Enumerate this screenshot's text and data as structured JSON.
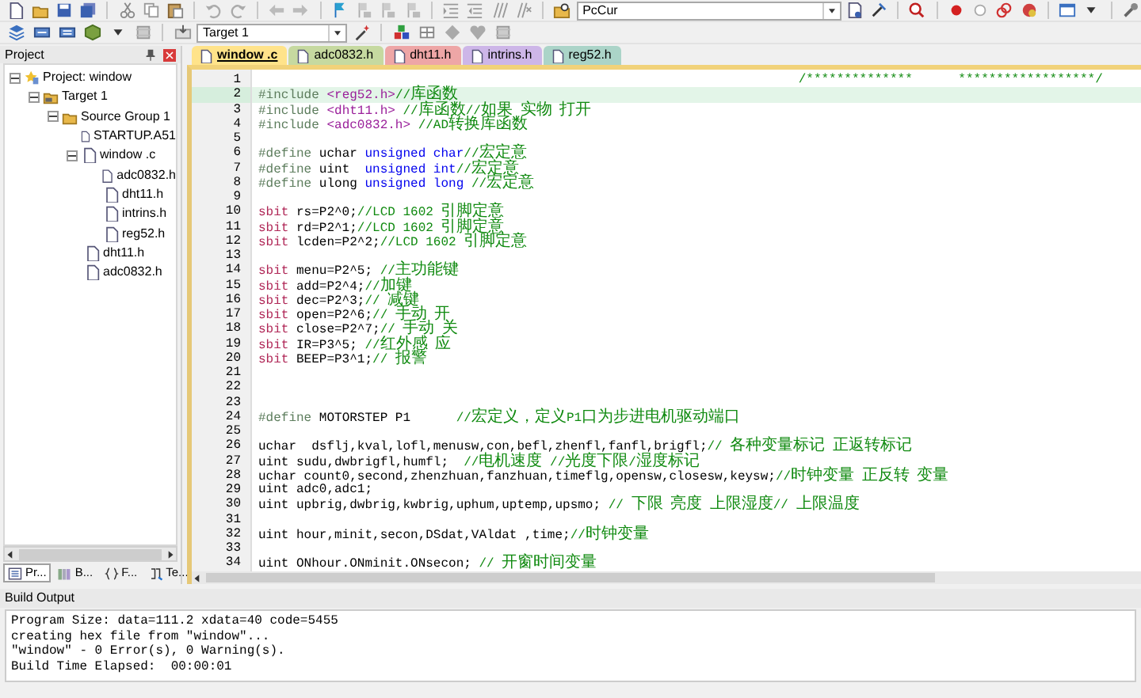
{
  "toolbar": {
    "debug_combo": {
      "value": "PcCur"
    },
    "target_combo": {
      "value": "Target 1"
    }
  },
  "project_panel": {
    "title": "Project",
    "tree": [
      {
        "label": "Project: window",
        "kind": "project",
        "expanded": true,
        "children": [
          {
            "label": "Target 1",
            "kind": "target",
            "expanded": true,
            "children": [
              {
                "label": "Source Group 1",
                "kind": "group",
                "expanded": true,
                "children": [
                  {
                    "label": "STARTUP.A51",
                    "kind": "file"
                  },
                  {
                    "label": "window .c",
                    "kind": "file",
                    "expanded": true,
                    "children": [
                      {
                        "label": "adc0832.h",
                        "kind": "file"
                      },
                      {
                        "label": "dht11.h",
                        "kind": "file"
                      },
                      {
                        "label": "intrins.h",
                        "kind": "file"
                      },
                      {
                        "label": "reg52.h",
                        "kind": "file"
                      }
                    ]
                  },
                  {
                    "label": "dht11.h",
                    "kind": "file"
                  },
                  {
                    "label": "adc0832.h",
                    "kind": "file"
                  }
                ]
              }
            ]
          }
        ]
      }
    ],
    "tabs": [
      {
        "label": "Pr...",
        "kind": "project",
        "selected": true
      },
      {
        "label": "B...",
        "kind": "books",
        "selected": false
      },
      {
        "label": "F...",
        "kind": "functions",
        "selected": false
      },
      {
        "label": "Te...",
        "kind": "templates",
        "selected": false
      }
    ]
  },
  "editor": {
    "tabs": [
      {
        "label": "window .c",
        "selected": true,
        "color": "#ffe38a"
      },
      {
        "label": "adc0832.h",
        "selected": false,
        "color": "#c6d9a0"
      },
      {
        "label": "dht11.h",
        "selected": false,
        "color": "#eea6a6"
      },
      {
        "label": "intrins.h",
        "selected": false,
        "color": "#cdb6e8"
      },
      {
        "label": "reg52.h",
        "selected": false,
        "color": "#abd4c8"
      }
    ],
    "lines": [
      {
        "number": "1",
        "current": false,
        "segments": [
          {
            "kind": "comment",
            "text": "                                                                       /**************      ******************/"
          }
        ]
      },
      {
        "number": "2",
        "current": true,
        "segments": [
          {
            "kind": "pp",
            "text": "#include "
          },
          {
            "kind": "header",
            "text": "<reg52.h>"
          },
          {
            "kind": "comment",
            "text": "//库函数"
          }
        ]
      },
      {
        "number": "3",
        "current": false,
        "segments": [
          {
            "kind": "pp",
            "text": "#include "
          },
          {
            "kind": "header",
            "text": "<dht11.h> "
          },
          {
            "kind": "comment",
            "text": "//库函数//如果 实物 打开"
          }
        ]
      },
      {
        "number": "4",
        "current": false,
        "segments": [
          {
            "kind": "pp",
            "text": "#include "
          },
          {
            "kind": "header",
            "text": "<adc0832.h> "
          },
          {
            "kind": "comment",
            "text": "//AD转换库函数"
          }
        ]
      },
      {
        "number": "5",
        "current": false
      },
      {
        "number": "6",
        "current": false,
        "segments": [
          {
            "kind": "pp",
            "text": "#define"
          },
          {
            "kind": "plain",
            "text": " uchar "
          },
          {
            "kind": "type",
            "text": "unsigned char"
          },
          {
            "kind": "comment",
            "text": "//宏定意"
          }
        ]
      },
      {
        "number": "7",
        "current": false,
        "segments": [
          {
            "kind": "pp",
            "text": "#define"
          },
          {
            "kind": "plain",
            "text": " uint  "
          },
          {
            "kind": "type",
            "text": "unsigned int"
          },
          {
            "kind": "comment",
            "text": "//宏定意"
          }
        ]
      },
      {
        "number": "8",
        "current": false,
        "segments": [
          {
            "kind": "pp",
            "text": "#define"
          },
          {
            "kind": "plain",
            "text": " ulong "
          },
          {
            "kind": "type",
            "text": "unsigned long "
          },
          {
            "kind": "comment",
            "text": "//宏定意"
          }
        ]
      },
      {
        "number": "9",
        "current": false
      },
      {
        "number": "10",
        "current": false,
        "segments": [
          {
            "kind": "keyword",
            "text": "sbit"
          },
          {
            "kind": "plain",
            "text": " rs=P2^0;"
          },
          {
            "kind": "comment",
            "text": "//LCD 1602 引脚定意"
          }
        ]
      },
      {
        "number": "11",
        "current": false,
        "segments": [
          {
            "kind": "keyword",
            "text": "sbit"
          },
          {
            "kind": "plain",
            "text": " rd=P2^1;"
          },
          {
            "kind": "comment",
            "text": "//LCD 1602 引脚定意"
          }
        ]
      },
      {
        "number": "12",
        "current": false,
        "segments": [
          {
            "kind": "keyword",
            "text": "sbit"
          },
          {
            "kind": "plain",
            "text": " lcden=P2^2;"
          },
          {
            "kind": "comment",
            "text": "//LCD 1602 引脚定意"
          }
        ]
      },
      {
        "number": "13",
        "current": false
      },
      {
        "number": "14",
        "current": false,
        "segments": [
          {
            "kind": "keyword",
            "text": "sbit"
          },
          {
            "kind": "plain",
            "text": " menu=P2^5; "
          },
          {
            "kind": "comment",
            "text": "//主功能键"
          }
        ]
      },
      {
        "number": "15",
        "current": false,
        "segments": [
          {
            "kind": "keyword",
            "text": "sbit"
          },
          {
            "kind": "plain",
            "text": " add=P2^4;"
          },
          {
            "kind": "comment",
            "text": "//加键"
          }
        ]
      },
      {
        "number": "16",
        "current": false,
        "segments": [
          {
            "kind": "keyword",
            "text": "sbit"
          },
          {
            "kind": "plain",
            "text": " dec=P2^3;"
          },
          {
            "kind": "comment",
            "text": "// 减键"
          }
        ]
      },
      {
        "number": "17",
        "current": false,
        "segments": [
          {
            "kind": "keyword",
            "text": "sbit"
          },
          {
            "kind": "plain",
            "text": " open=P2^6;"
          },
          {
            "kind": "comment",
            "text": "// 手动 开"
          }
        ]
      },
      {
        "number": "18",
        "current": false,
        "segments": [
          {
            "kind": "keyword",
            "text": "sbit"
          },
          {
            "kind": "plain",
            "text": " close=P2^7;"
          },
          {
            "kind": "comment",
            "text": "// 手动 关"
          }
        ]
      },
      {
        "number": "19",
        "current": false,
        "segments": [
          {
            "kind": "keyword",
            "text": "sbit"
          },
          {
            "kind": "plain",
            "text": " IR=P3^5; "
          },
          {
            "kind": "comment",
            "text": "//红外感 应"
          }
        ]
      },
      {
        "number": "20",
        "current": false,
        "segments": [
          {
            "kind": "keyword",
            "text": "sbit"
          },
          {
            "kind": "plain",
            "text": " BEEP=P3^1;"
          },
          {
            "kind": "comment",
            "text": "// 报警"
          }
        ]
      },
      {
        "number": "21",
        "current": false
      },
      {
        "number": "22",
        "current": false
      },
      {
        "number": "23",
        "current": false
      },
      {
        "number": "24",
        "current": false,
        "segments": [
          {
            "kind": "pp",
            "text": "#define"
          },
          {
            "kind": "plain",
            "text": " MOTORSTEP P1      "
          },
          {
            "kind": "comment",
            "text": "//宏定义，定义P1口为步进电机驱动端口"
          }
        ]
      },
      {
        "number": "25",
        "current": false
      },
      {
        "number": "26",
        "current": false,
        "segments": [
          {
            "kind": "plain",
            "text": "uchar  dsflj,kval,lofl,menusw,con,befl,zhenfl,fanfl,brigfl;"
          },
          {
            "kind": "comment",
            "text": "// 各种变量标记 正返转标记"
          }
        ]
      },
      {
        "number": "27",
        "current": false,
        "segments": [
          {
            "kind": "plain",
            "text": "uint sudu,dwbrigfl,humfl;  "
          },
          {
            "kind": "comment",
            "text": "//电机速度 //光度下限/湿度标记"
          }
        ]
      },
      {
        "number": "28",
        "current": false,
        "segments": [
          {
            "kind": "plain",
            "text": "uchar count0,second,zhenzhuan,fanzhuan,timeflg,opensw,closesw,keysw;"
          },
          {
            "kind": "comment",
            "text": "//时钟变量 正反转 变量"
          }
        ]
      },
      {
        "number": "29",
        "current": false,
        "segments": [
          {
            "kind": "plain",
            "text": "uint adc0,adc1;"
          }
        ]
      },
      {
        "number": "30",
        "current": false,
        "segments": [
          {
            "kind": "plain",
            "text": "uint upbrig,dwbrig,kwbrig,uphum,uptemp,upsmo; "
          },
          {
            "kind": "comment",
            "text": "// 下限 亮度 上限湿度// 上限温度"
          }
        ]
      },
      {
        "number": "31",
        "current": false
      },
      {
        "number": "32",
        "current": false,
        "segments": [
          {
            "kind": "plain",
            "text": "uint hour,minit,secon,DSdat,VAldat ,time;"
          },
          {
            "kind": "comment",
            "text": "//时钟变量"
          }
        ]
      },
      {
        "number": "33",
        "current": false
      },
      {
        "number": "34",
        "current": false,
        "segments": [
          {
            "kind": "plain",
            "text": "uint ONhour.ONminit.ONsecon; "
          },
          {
            "kind": "comment",
            "text": "// 开窗时间变量"
          }
        ]
      }
    ]
  },
  "build_output": {
    "title": "Build Output",
    "lines": [
      "Program Size: data=111.2 xdata=40 code=5455",
      "creating hex file from \"window\"...",
      "\"window\" - 0 Error(s), 0 Warning(s).",
      "Build Time Elapsed:  00:00:01"
    ]
  }
}
